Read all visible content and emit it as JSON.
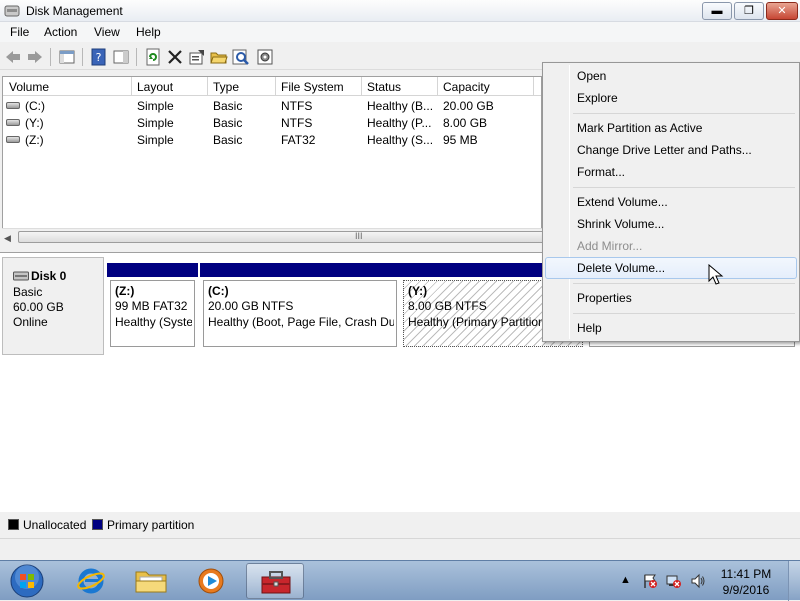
{
  "window": {
    "title": "Disk Management",
    "minimize": "▬",
    "maximize": "❐",
    "close": "✕"
  },
  "menubar": [
    "File",
    "Action",
    "View",
    "Help"
  ],
  "volume_list": {
    "columns": [
      "Volume",
      "Layout",
      "Type",
      "File System",
      "Status",
      "Capacity"
    ],
    "rows": [
      {
        "volume": "(C:)",
        "layout": "Simple",
        "type": "Basic",
        "fs": "NTFS",
        "status": "Healthy (B...",
        "capacity": "20.00 GB"
      },
      {
        "volume": "(Y:)",
        "layout": "Simple",
        "type": "Basic",
        "fs": "NTFS",
        "status": "Healthy (P...",
        "capacity": "8.00 GB"
      },
      {
        "volume": "(Z:)",
        "layout": "Simple",
        "type": "Basic",
        "fs": "FAT32",
        "status": "Healthy (S...",
        "capacity": "95 MB"
      }
    ],
    "scroll_grip": "III"
  },
  "disk": {
    "name": "Disk 0",
    "type": "Basic",
    "size": "60.00 GB",
    "state": "Online",
    "partitions": [
      {
        "name": "(Z:)",
        "size": "99 MB FAT32",
        "status": "Healthy (System"
      },
      {
        "name": "(C:)",
        "size": "20.00 GB NTFS",
        "status": "Healthy (Boot, Page File, Crash Dur"
      },
      {
        "name": "(Y:)",
        "size": "8.00 GB NTFS",
        "status": "Healthy (Primary Partition"
      }
    ]
  },
  "legend": {
    "unallocated": "Unallocated",
    "primary": "Primary partition",
    "colors": {
      "unallocated": "#000000",
      "primary": "#000080"
    }
  },
  "context_menu": {
    "items": [
      {
        "label": "Open",
        "enabled": true
      },
      {
        "label": "Explore",
        "enabled": true
      },
      {
        "label": "Mark Partition as Active",
        "enabled": true
      },
      {
        "label": "Change Drive Letter and Paths...",
        "enabled": true
      },
      {
        "label": "Format...",
        "enabled": true
      },
      {
        "label": "Extend Volume...",
        "enabled": true
      },
      {
        "label": "Shrink Volume...",
        "enabled": true
      },
      {
        "label": "Add Mirror...",
        "enabled": false
      },
      {
        "label": "Delete Volume...",
        "enabled": true,
        "highlighted": true
      },
      {
        "label": "Properties",
        "enabled": true
      },
      {
        "label": "Help",
        "enabled": true
      }
    ]
  },
  "taskbar": {
    "time": "11:41 PM",
    "date": "9/9/2016",
    "tray_overflow": "▲"
  }
}
